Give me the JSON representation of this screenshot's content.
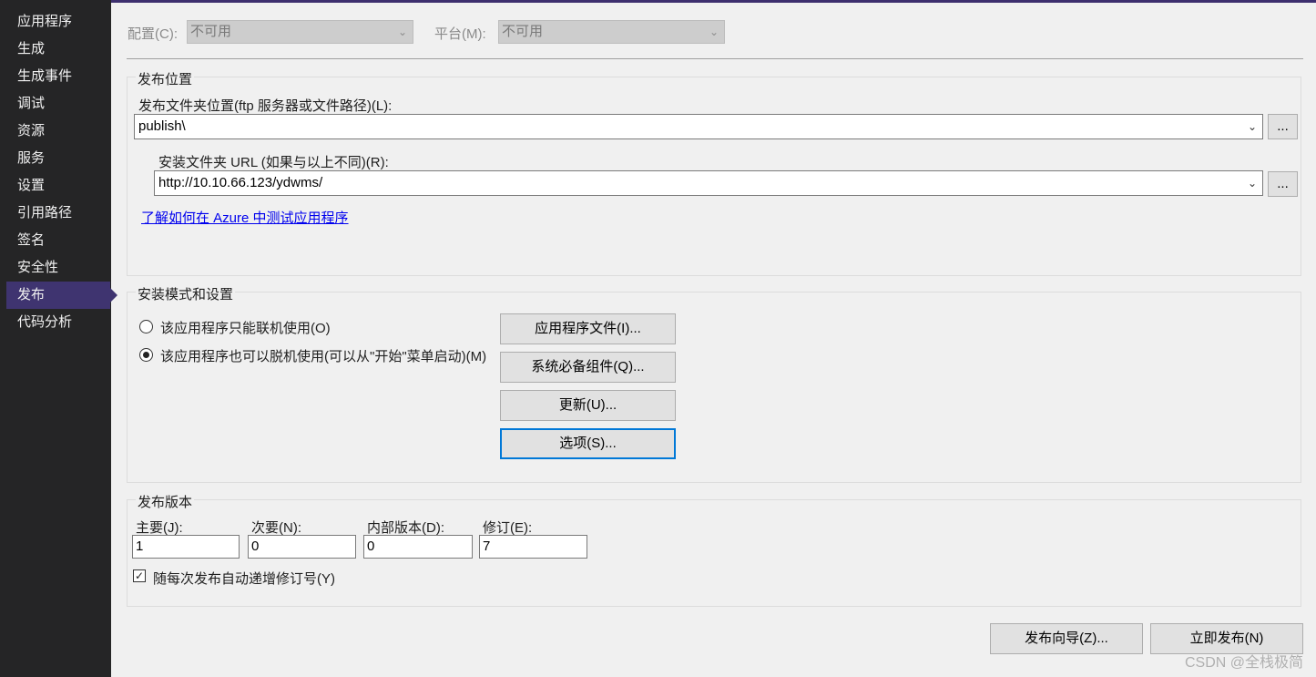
{
  "sidebar": {
    "items": [
      {
        "label": "应用程序"
      },
      {
        "label": "生成"
      },
      {
        "label": "生成事件"
      },
      {
        "label": "调试"
      },
      {
        "label": "资源"
      },
      {
        "label": "服务"
      },
      {
        "label": "设置"
      },
      {
        "label": "引用路径"
      },
      {
        "label": "签名"
      },
      {
        "label": "安全性"
      },
      {
        "label": "发布",
        "active": true
      },
      {
        "label": "代码分析"
      }
    ]
  },
  "toolbar": {
    "config_label": "配置(C):",
    "config_value": "不可用",
    "platform_label": "平台(M):",
    "platform_value": "不可用"
  },
  "publish_location": {
    "title": "发布位置",
    "folder_label": "发布文件夹位置(ftp 服务器或文件路径)(L):",
    "folder_value": "publish\\",
    "browse_label": "...",
    "install_url_label": "安装文件夹 URL (如果与以上不同)(R):",
    "install_url_value": "http://10.10.66.123/ydwms/",
    "azure_link": "了解如何在 Azure 中测试应用程序"
  },
  "install_mode": {
    "title": "安装模式和设置",
    "online_only": "该应用程序只能联机使用(O)",
    "offline": "该应用程序也可以脱机使用(可以从\"开始\"菜单启动)(M)",
    "selected": "offline",
    "buttons": {
      "app_files": "应用程序文件(I)...",
      "prerequisites": "系统必备组件(Q)...",
      "updates": "更新(U)...",
      "options": "选项(S)..."
    }
  },
  "publish_version": {
    "title": "发布版本",
    "major_label": "主要(J):",
    "minor_label": "次要(N):",
    "build_label": "内部版本(D):",
    "revision_label": "修订(E):",
    "major": "1",
    "minor": "0",
    "build": "0",
    "revision": "7",
    "auto_increment_label": "随每次发布自动递增修订号(Y)",
    "auto_increment_checked": true
  },
  "footer": {
    "wizard_button": "发布向导(Z)...",
    "publish_now_button": "立即发布(N)"
  },
  "watermark": "CSDN @全栈极简"
}
